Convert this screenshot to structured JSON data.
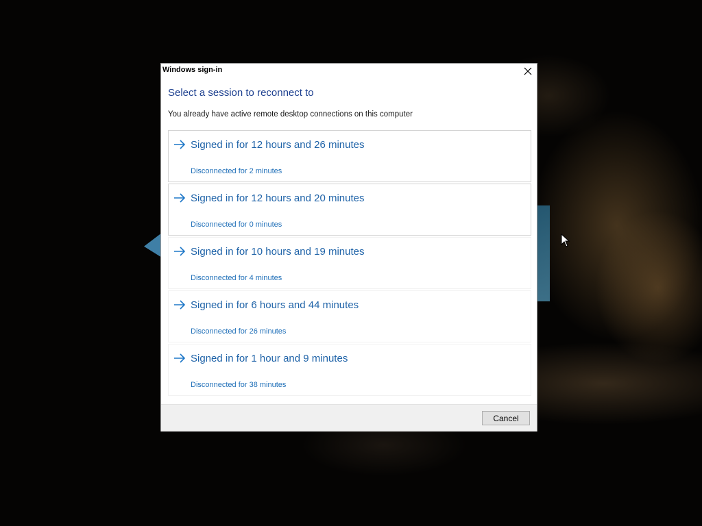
{
  "dialog": {
    "title": "Windows sign-in",
    "heading": "Select a session to reconnect to",
    "description": "You already have active remote desktop connections on this computer",
    "sessions": [
      {
        "signed_in": "Signed in for 12 hours and 26 minutes",
        "disconnected": "Disconnected for 2 minutes"
      },
      {
        "signed_in": "Signed in for 12 hours and 20 minutes",
        "disconnected": "Disconnected for 0 minutes"
      },
      {
        "signed_in": "Signed in for 10 hours and 19 minutes",
        "disconnected": "Disconnected for 4 minutes"
      },
      {
        "signed_in": "Signed in for 6 hours and 44 minutes",
        "disconnected": "Disconnected for 26 minutes"
      },
      {
        "signed_in": "Signed in for 1 hour and 9 minutes",
        "disconnected": "Disconnected for 38 minutes"
      }
    ],
    "cancel_label": "Cancel"
  },
  "icons": {
    "close": "close-icon",
    "session_arrow": "arrow-right-icon",
    "cursor": "mouse-pointer-icon"
  },
  "colors": {
    "heading": "#1c3f8f",
    "session_text": "#1f63a8",
    "arrow": "#1f78c8",
    "footer_bg": "#f0f0f0"
  }
}
